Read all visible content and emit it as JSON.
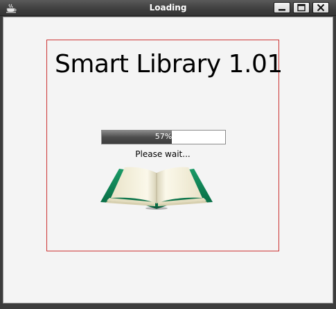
{
  "window": {
    "title": "Loading",
    "controls": {
      "minimize": "minimize-icon",
      "maximize": "maximize-icon",
      "close": "close-icon"
    }
  },
  "splash": {
    "app_title": "Smart Library 1.01",
    "progress": {
      "label": "57%",
      "value": 0.57
    },
    "status": "Please wait...",
    "image": "open-book-icon"
  },
  "colors": {
    "panel_border": "#cc3333",
    "progress_fill": "#4e4e4e",
    "book_cover": "#0a7a4e"
  }
}
